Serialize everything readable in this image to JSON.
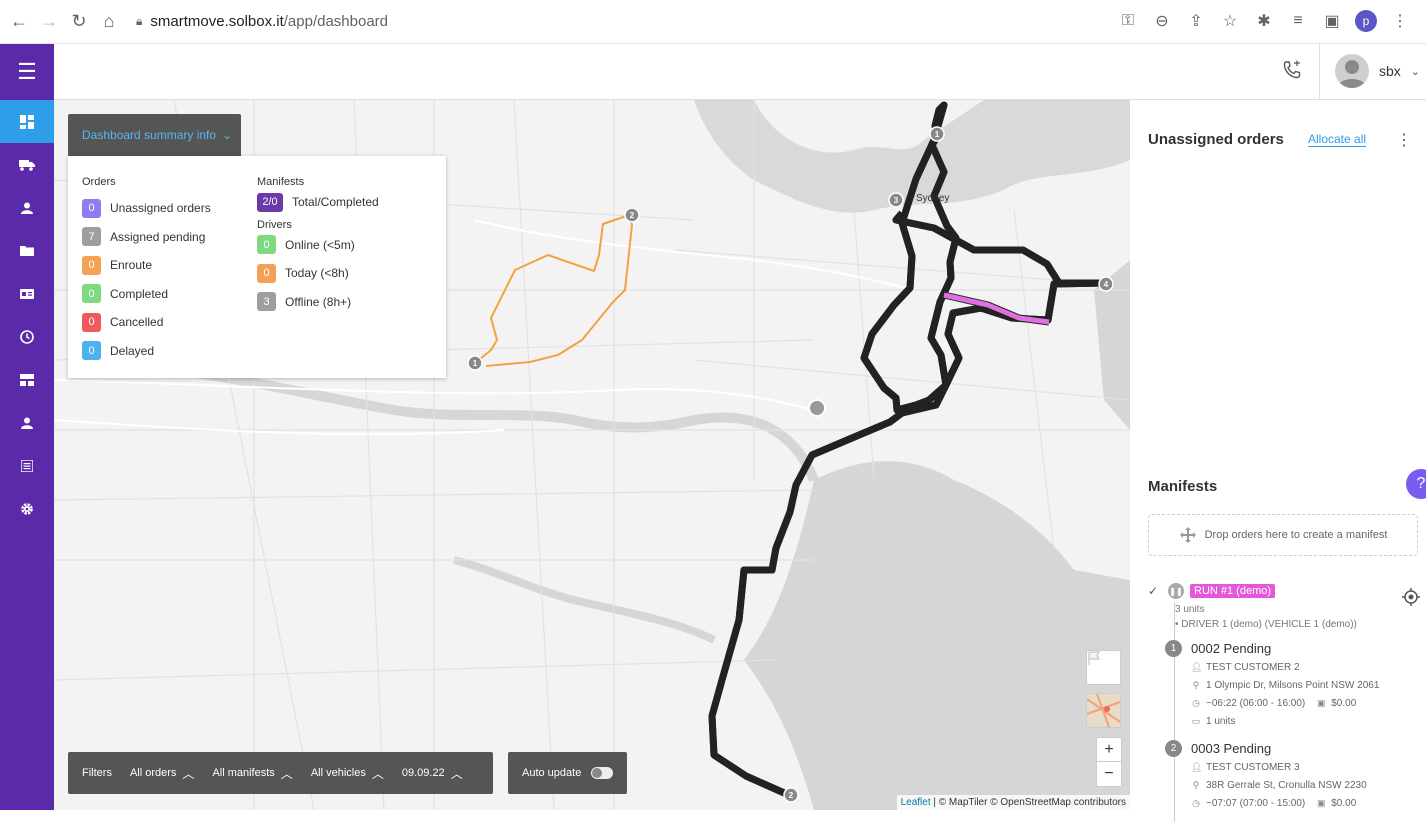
{
  "browser": {
    "url_host": "smartmove.solbox.it",
    "url_path": "/app/dashboard",
    "profile_initial": "p"
  },
  "header": {
    "user_name": "sbx"
  },
  "summary": {
    "button_label": "Dashboard summary info",
    "orders_title": "Orders",
    "orders": [
      {
        "count": "0",
        "label": "Unassigned orders",
        "color": "#8d7ef0"
      },
      {
        "count": "7",
        "label": "Assigned pending",
        "color": "#9e9e9e"
      },
      {
        "count": "0",
        "label": "Enroute",
        "color": "#f5a155"
      },
      {
        "count": "0",
        "label": "Completed",
        "color": "#7ed97f"
      },
      {
        "count": "0",
        "label": "Cancelled",
        "color": "#f05a5a"
      },
      {
        "count": "0",
        "label": "Delayed",
        "color": "#4db1f0"
      }
    ],
    "manifests_title": "Manifests",
    "manifests": {
      "count": "2/0",
      "label": "Total/Completed",
      "color": "#6a3aa8"
    },
    "drivers_title": "Drivers",
    "drivers": [
      {
        "count": "0",
        "label": "Online (<5m)",
        "color": "#7ed97f"
      },
      {
        "count": "0",
        "label": "Today (<8h)",
        "color": "#f5a155"
      },
      {
        "count": "3",
        "label": "Offline (8h+)",
        "color": "#9e9e9e"
      }
    ]
  },
  "filters": {
    "label": "Filters",
    "orders": "All orders",
    "manifests": "All manifests",
    "vehicles": "All vehicles",
    "date": "09.09.22",
    "auto_update": "Auto update"
  },
  "map": {
    "city_label": "Sydney",
    "markers": [
      "1",
      "2",
      "3",
      "4",
      "1",
      "2"
    ],
    "attribution_leaflet": "Leaflet",
    "attribution_rest": " | © MapTiler © OpenStreetMap contributors",
    "route_colors": {
      "manifest_1": "#e070e0",
      "manifest_2": "#f5a040"
    }
  },
  "right_panel": {
    "unassigned_title": "Unassigned orders",
    "allocate_all": "Allocate all",
    "manifests_title": "Manifests",
    "drop_zone": "Drop orders here to create a manifest",
    "run": {
      "tag": "RUN #1 (demo)",
      "units": "3 units",
      "driver": "DRIVER 1 (demo) (VEHICLE 1 (demo))"
    },
    "stops": [
      {
        "num": "1",
        "title": "0002 Pending",
        "customer": "TEST CUSTOMER 2",
        "address": "1 Olympic Dr, Milsons Point NSW 2061",
        "time": "~06:22 (06:00 - 16:00)",
        "price": "$0.00",
        "units": "1 units"
      },
      {
        "num": "2",
        "title": "0003 Pending",
        "customer": "TEST CUSTOMER 3",
        "address": "38R Gerrale St, Cronulla NSW 2230",
        "time": "~07:07 (07:00 - 15:00)",
        "price": "$0.00"
      }
    ]
  }
}
